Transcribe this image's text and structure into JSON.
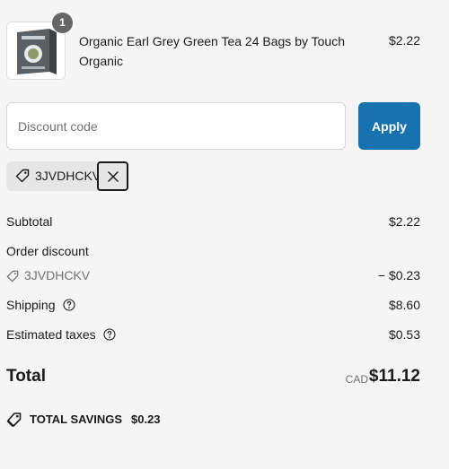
{
  "cart": {
    "items": [
      {
        "quantity": "1",
        "name": "Organic Earl Grey Green Tea 24 Bags by Touch Organic",
        "price": "$2.22",
        "image_icon": "tea-box-image"
      }
    ]
  },
  "discount": {
    "placeholder": "Discount code",
    "apply_label": "Apply",
    "applied_code": "3JVDHCKV"
  },
  "summary": {
    "subtotal_label": "Subtotal",
    "subtotal_value": "$2.22",
    "order_discount_label": "Order discount",
    "order_discount_code": "3JVDHCKV",
    "order_discount_value": "− $0.23",
    "shipping_label": "Shipping",
    "shipping_value": "$8.60",
    "taxes_label": "Estimated taxes",
    "taxes_value": "$0.53",
    "total_label": "Total",
    "total_currency": "CAD",
    "total_value": "$11.12",
    "savings_label": "TOTAL SAVINGS",
    "savings_value": "$0.23"
  },
  "colors": {
    "accent": "#1773b0",
    "background": "#f5f5f5",
    "muted_text": "#707070"
  }
}
